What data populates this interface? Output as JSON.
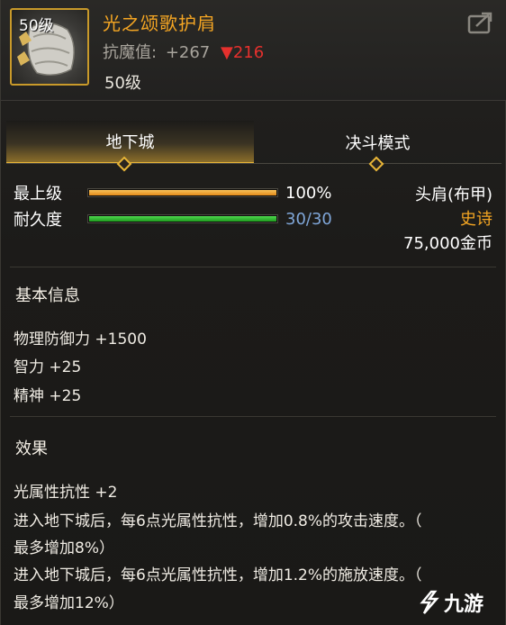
{
  "item": {
    "level_badge": "50级",
    "title": "光之颂歌护肩",
    "stat_label": "抗魔值:",
    "stat_value": "+267",
    "stat_down_arrow": "▼",
    "stat_down_value": "216",
    "level_text": "50级"
  },
  "tabs": [
    {
      "label": "地下城",
      "active": true
    },
    {
      "label": "决斗模式",
      "active": false
    }
  ],
  "bars": {
    "top": {
      "label": "最上级",
      "value_text": "100%",
      "fraction": 1.0,
      "color": "#f5a623"
    },
    "durability": {
      "label": "耐久度",
      "value_text": "30/30",
      "fraction": 1.0,
      "color": "#2fbf2f",
      "text_color": "#7fa6d8"
    }
  },
  "info": {
    "slot": "头肩(布甲)",
    "rarity": "史诗",
    "rarity_color": "#f5a623",
    "price": "75,000金币"
  },
  "basic": {
    "title": "基本信息",
    "lines": [
      "物理防御力 +1500",
      "智力 +25",
      "精神 +25"
    ]
  },
  "effect": {
    "title": "效果",
    "lines": [
      "光属性抗性 +2",
      "进入地下城后，每6点光属性抗性，增加0.8%的攻击速度。（",
      "最多增加8%）",
      "进入地下城后，每6点光属性抗性，增加1.2%的施放速度。（",
      "最多增加12%）"
    ]
  },
  "watermark": {
    "text": "九游"
  },
  "icons": {
    "export": "export-icon",
    "item": "shoulder-armor-icon",
    "diamond": "diamond-icon"
  }
}
